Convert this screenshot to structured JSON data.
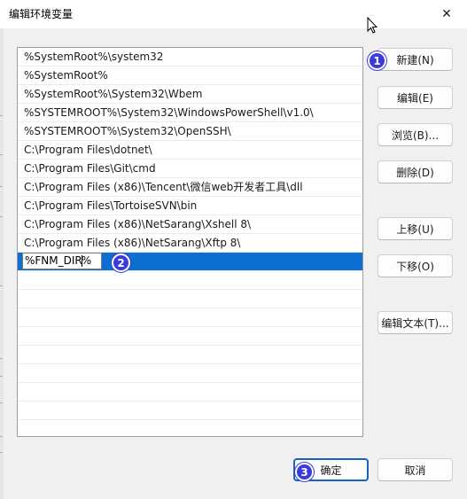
{
  "window": {
    "title": "编辑环境变量",
    "close_glyph": "✕"
  },
  "path_list": {
    "items": [
      "%SystemRoot%\\system32",
      "%SystemRoot%",
      "%SystemRoot%\\System32\\Wbem",
      "%SYSTEMROOT%\\System32\\WindowsPowerShell\\v1.0\\",
      "%SYSTEMROOT%\\System32\\OpenSSH\\",
      "C:\\Program Files\\dotnet\\",
      "C:\\Program Files\\Git\\cmd",
      "C:\\Program Files (x86)\\Tencent\\微信web开发者工具\\dll",
      "C:\\Program Files\\TortoiseSVN\\bin",
      "C:\\Program Files (x86)\\NetSarang\\Xshell 8\\",
      "C:\\Program Files (x86)\\NetSarang\\Xftp 8\\"
    ],
    "editing_value_before_caret": "%FNM_DIR",
    "editing_value_after_caret": "%",
    "empty_rows": 9
  },
  "buttons": {
    "new": "新建(N)",
    "edit": "编辑(E)",
    "browse": "浏览(B)...",
    "delete": "删除(D)",
    "move_up": "上移(U)",
    "move_down": "下移(O)",
    "edit_text": "编辑文本(T)...",
    "ok": "确定",
    "cancel": "取消"
  },
  "annotations": {
    "step1": "1",
    "step2": "2",
    "step3": "3"
  },
  "colors": {
    "selection": "#0b6fd1",
    "badge": "#3b3bd9",
    "primary_border": "#1663c7"
  },
  "icons": {
    "close": "close-icon",
    "cursor": "mouse-pointer-icon"
  }
}
